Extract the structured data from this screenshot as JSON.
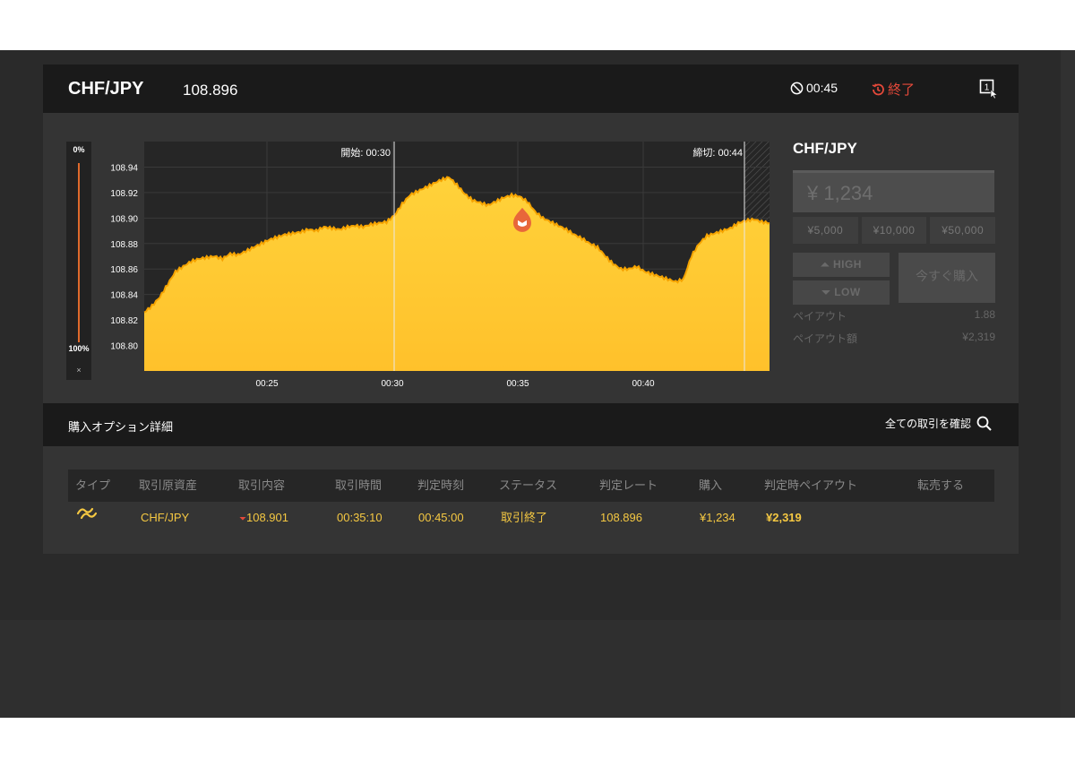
{
  "header": {
    "pair": "CHF/JPY",
    "price": "108.896",
    "timer": "00:45",
    "ended_label": "終了"
  },
  "slider": {
    "top_label": "0%",
    "bottom_label": "100%",
    "close_label": "×"
  },
  "chart_data": {
    "type": "area",
    "x_ticks": [
      "00:25",
      "00:30",
      "00:35",
      "00:40"
    ],
    "y_ticks": [
      "108.94",
      "108.92",
      "108.90",
      "108.88",
      "108.86",
      "108.84",
      "108.82",
      "108.80"
    ],
    "ylim": [
      108.78,
      108.96
    ],
    "start_label": "開始: 00:30",
    "end_label": "締切: 00:44",
    "entry_rate": 108.901,
    "series": [
      {
        "values": [
          108.826,
          108.831,
          108.838,
          108.848,
          108.858,
          108.862,
          108.866,
          108.868,
          108.869,
          108.87,
          108.868,
          108.872,
          108.871,
          108.874,
          108.877,
          108.88,
          108.883,
          108.885,
          108.887,
          108.888,
          108.889,
          108.891,
          108.89,
          108.893,
          108.892,
          108.891,
          108.893,
          108.894,
          108.893,
          108.895,
          108.896,
          108.897,
          108.902,
          108.911,
          108.918,
          108.921,
          108.924,
          108.927,
          108.93,
          108.932,
          108.926,
          108.919,
          108.914,
          108.912,
          108.91,
          108.913,
          108.916,
          108.918,
          108.917,
          108.913,
          108.905,
          108.9,
          108.897,
          108.894,
          108.891,
          108.887,
          108.884,
          108.88,
          108.877,
          108.87,
          108.864,
          108.86,
          108.86,
          108.862,
          108.858,
          108.856,
          108.854,
          108.852,
          108.85,
          108.852,
          108.87,
          108.88,
          108.886,
          108.888,
          108.89,
          108.892,
          108.896,
          108.898,
          108.899,
          108.897,
          108.896
        ]
      }
    ]
  },
  "trade": {
    "pair": "CHF/JPY",
    "amount": "¥ 1,234",
    "quick": [
      "¥5,000",
      "¥10,000",
      "¥50,000"
    ],
    "high": "HIGH",
    "low": "LOW",
    "buy_now": "今すぐ購入",
    "payout_label": "ペイアウト",
    "payout_value": "1.88",
    "payout_amount_label": "ペイアウト額",
    "payout_amount_value": "¥2,319"
  },
  "options": {
    "title": "購入オプション詳細",
    "all_trades_link": "全ての取引を確認"
  },
  "table": {
    "headers": [
      "タイプ",
      "取引原資産",
      "取引内容",
      "取引時間",
      "判定時刻",
      "ステータス",
      "判定レート",
      "購入",
      "判定時ペイアウト",
      "転売する"
    ],
    "row": {
      "asset": "CHF/JPY",
      "content": "108.901",
      "trade_time": "00:35:10",
      "judge_time": "00:45:00",
      "status": "取引終了",
      "judge_rate": "108.896",
      "purchase": "¥1,234",
      "payout": "¥2,319"
    }
  },
  "colors": {
    "accent": "#f5c842",
    "area_top": "#ffcc33",
    "area_line": "#f5a300",
    "alert": "#e5493a",
    "marker": "#e8673a"
  }
}
